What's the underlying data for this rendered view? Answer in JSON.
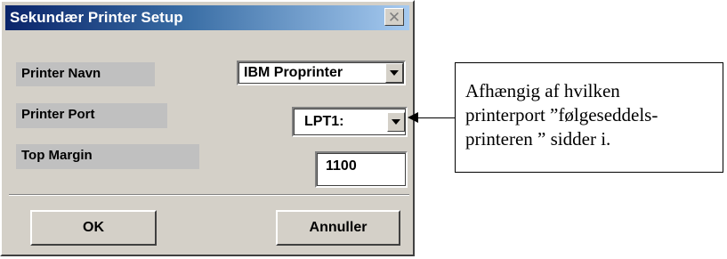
{
  "dialog": {
    "title": "Sekundær Printer Setup",
    "close_symbol": "✕",
    "fields": {
      "printer_name": {
        "label": "Printer Navn",
        "value": "IBM Proprinter"
      },
      "printer_port": {
        "label": "Printer Port",
        "value": "LPT1:"
      },
      "top_margin": {
        "label": "Top Margin",
        "value": "1100"
      }
    },
    "buttons": {
      "ok": "OK",
      "cancel": "Annuller"
    }
  },
  "annotation": {
    "lines": [
      "Afhængig af hvilken",
      "printerport ”følgeseddels-",
      "printeren ” sidder i."
    ]
  },
  "colors": {
    "dialog_face": "#d4d0c8",
    "titlebar_start": "#0a246a",
    "titlebar_end": "#a6caf0",
    "label_background": "#c0c0c0"
  },
  "icons": {
    "close": "close-icon",
    "dropdown": "chevron-down-icon",
    "arrow": "arrow-left-icon"
  }
}
